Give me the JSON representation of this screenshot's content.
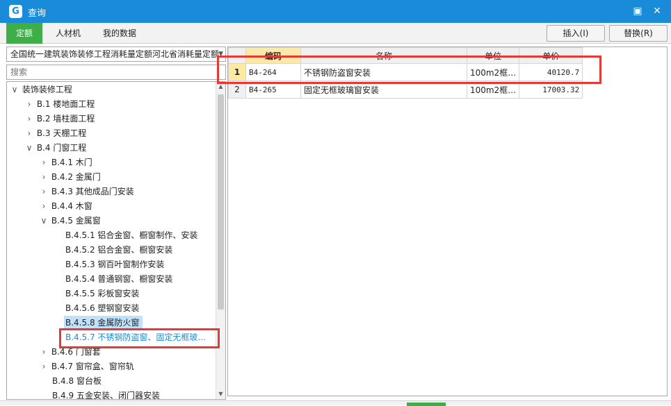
{
  "window": {
    "title": "查询",
    "app_icon": "G",
    "min_label": "▣",
    "close_label": "✕"
  },
  "tabs": [
    {
      "label": "定额",
      "active": true
    },
    {
      "label": "人材机",
      "active": false
    },
    {
      "label": "我的数据",
      "active": false
    }
  ],
  "toolbar": {
    "insert_label": "插入(I)",
    "replace_label": "替换(R)"
  },
  "left_panel": {
    "dropdown_value": "全国统一建筑装饰装修工程消耗量定额河北省消耗量定额",
    "search_placeholder": "搜索"
  },
  "tree": {
    "nodes": [
      {
        "label": "装饰装修工程",
        "toggle": "∨"
      },
      {
        "label": "B.1 楼地面工程",
        "toggle": "›"
      },
      {
        "label": "B.2 墙柱面工程",
        "toggle": "›"
      },
      {
        "label": "B.3 天棚工程",
        "toggle": "›"
      },
      {
        "label": "B.4 门窗工程",
        "toggle": "∨"
      },
      {
        "label": "B.4.1 木门",
        "toggle": "›"
      },
      {
        "label": "B.4.2 金属门",
        "toggle": "›"
      },
      {
        "label": "B.4.3 其他成品门安装",
        "toggle": "›"
      },
      {
        "label": "B.4.4 木窗",
        "toggle": "›"
      },
      {
        "label": "B.4.5 金属窗",
        "toggle": "∨"
      },
      {
        "label": "B.4.5.1 铝合金窗、橱窗制作、安装",
        "toggle": ""
      },
      {
        "label": "B.4.5.2 铝合金窗、橱窗安装",
        "toggle": ""
      },
      {
        "label": "B.4.5.3 钢百叶窗制作安装",
        "toggle": ""
      },
      {
        "label": "B.4.5.4 普通钢窗、橱窗安装",
        "toggle": ""
      },
      {
        "label": "B.4.5.5 彩板窗安装",
        "toggle": ""
      },
      {
        "label": "B.4.5.6 塑钢窗安装",
        "toggle": ""
      },
      {
        "label": "B.4.5.8 金属防火窗",
        "toggle": ""
      },
      {
        "label": "B.4.5.7 不锈钢防盗窗、固定无框玻…",
        "toggle": ""
      },
      {
        "label": "B.4.6 门窗套",
        "toggle": "›"
      },
      {
        "label": "B.4.7 窗帘盒、窗帘轨",
        "toggle": "›"
      },
      {
        "label": "B.4.8 窗台板",
        "toggle": ""
      },
      {
        "label": "B.4.9 五金安装、闭门器安装",
        "toggle": ""
      }
    ],
    "scroll_up": "▲",
    "scroll_down": "▼"
  },
  "grid": {
    "headers": [
      "",
      "编码",
      "名称",
      "单位",
      "单价"
    ],
    "rows": [
      {
        "no": "1",
        "code": "B4-264",
        "name": "不锈钢防盗窗安装",
        "unit": "100m2框…",
        "price": "40120.7"
      },
      {
        "no": "2",
        "code": "B4-265",
        "name": "固定无框玻璃窗安装",
        "unit": "100m2框…",
        "price": "17003.32"
      }
    ]
  },
  "colors": {
    "titlebar": "#1a8bd9",
    "active_tab": "#3fae49",
    "highlight_box": "#e53935",
    "selected_row": "#bfe1fb",
    "sorted_header": "#fde9a6"
  }
}
